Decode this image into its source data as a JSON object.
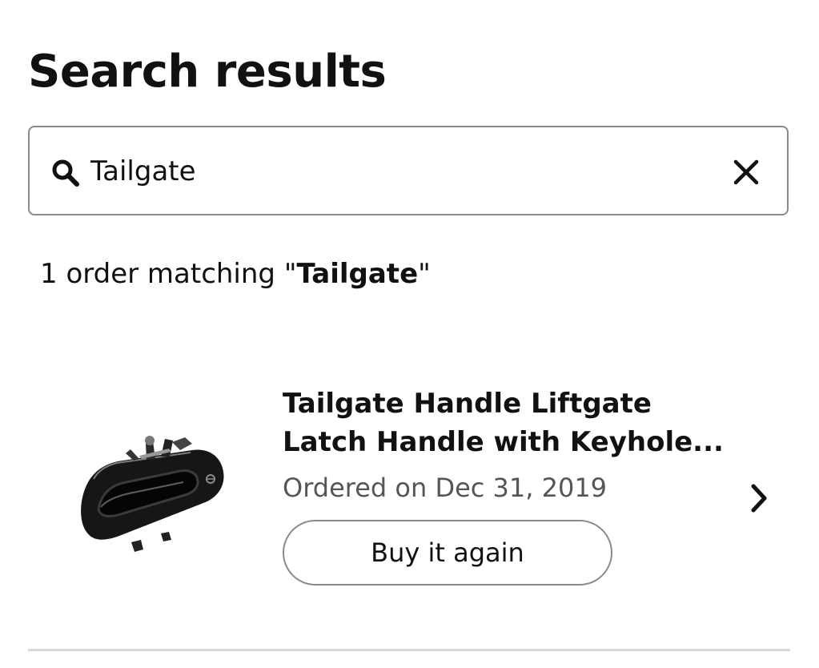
{
  "page": {
    "title": "Search results"
  },
  "search": {
    "value": "Tailgate",
    "icon": "search-icon",
    "clear_icon": "close-icon"
  },
  "results_summary": {
    "prefix": "1 order matching \"",
    "query": "Tailgate",
    "suffix": "\""
  },
  "orders": [
    {
      "title_line_1": "Tailgate Handle Liftgate",
      "title_line_2": "Latch Handle with Keyhole...",
      "ordered_on": "Ordered on Dec 31, 2019",
      "buy_again_label": "Buy it again",
      "image": "tailgate-handle-product-image",
      "action_icon": "chevron-right-icon"
    }
  ],
  "colors": {
    "text": "#111111",
    "secondary_text": "#565656",
    "border": "#8a8a8a",
    "divider": "#d5d9d9"
  }
}
